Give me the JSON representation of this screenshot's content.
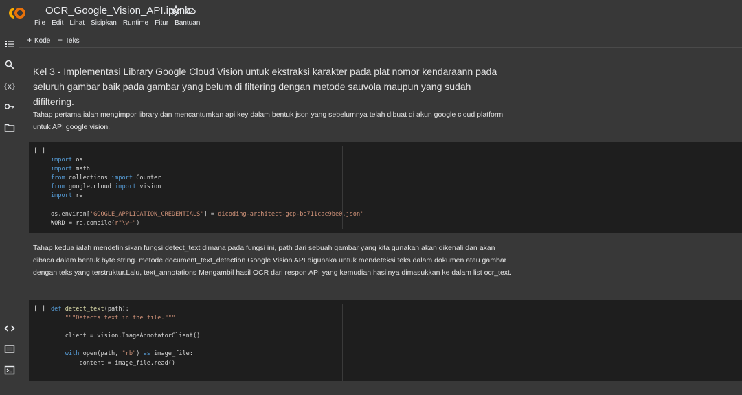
{
  "app": {
    "title": "OCR_Google_Vision_API.ipynb",
    "logo_text": "CO",
    "colors": {
      "logo_orange": "#f9ab00",
      "logo_dark_orange": "#e8710a",
      "background": "#383838",
      "cell_background": "#1e1e1e",
      "keyword": "#569cd6",
      "string": "#ce9178"
    }
  },
  "menu": [
    "File",
    "Edit",
    "Lihat",
    "Sisipkan",
    "Runtime",
    "Fitur",
    "Bantuan"
  ],
  "toolbar": {
    "add_code": "Kode",
    "add_text": "Teks"
  },
  "sidebar_icons": [
    "toc-icon",
    "search-icon",
    "variables-icon",
    "key-icon",
    "folder-icon",
    "code-snippets-icon",
    "command-palette-icon",
    "terminal-icon"
  ],
  "cells": {
    "heading": "Kel 3 - Implementasi Library Google Cloud Vision untuk ekstraksi karakter pada plat nomor kendaraann pada seluruh gambar baik pada gambar yang belum di filtering dengan metode sauvola maupun yang sudah difiltering.",
    "text1": "Tahap pertama ialah mengimpor library dan mencantumkan api key dalam bentuk json yang sebelumnya telah dibuat di akun google cloud platform untuk API google vision.",
    "code1_run": "[ ]",
    "code1": [
      "import os",
      "import math",
      "from collections import Counter",
      "from google.cloud import vision",
      "import re",
      "",
      "os.environ['GOOGLE_APPLICATION_CREDENTIALS'] ='dicoding-architect-gcp-be711cac9be0.json'",
      "WORD = re.compile(r\"\\w+\")"
    ],
    "text2": "Tahap kedua ialah mendefinisikan fungsi detect_text dimana pada fungsi ini, path dari sebuah gambar yang kita gunakan akan dikenali dan akan dibaca dalam bentuk byte string. metode document_text_detection Google Vision API digunaka untuk mendeteksi teks dalam dokumen atau gambar dengan teks yang terstruktur.Lalu, text_annotations Mengambil hasil OCR dari respon API yang kemudian hasilnya dimasukkan ke dalam list ocr_text.",
    "code2_run": "[ ]",
    "code2": [
      "def detect_text(path):",
      "    \"\"\"Detects text in the file.\"\"\"",
      "",
      "    client = vision.ImageAnnotatorClient()",
      "",
      "    with open(path, \"rb\") as image_file:",
      "        content = image_file.read()"
    ]
  }
}
